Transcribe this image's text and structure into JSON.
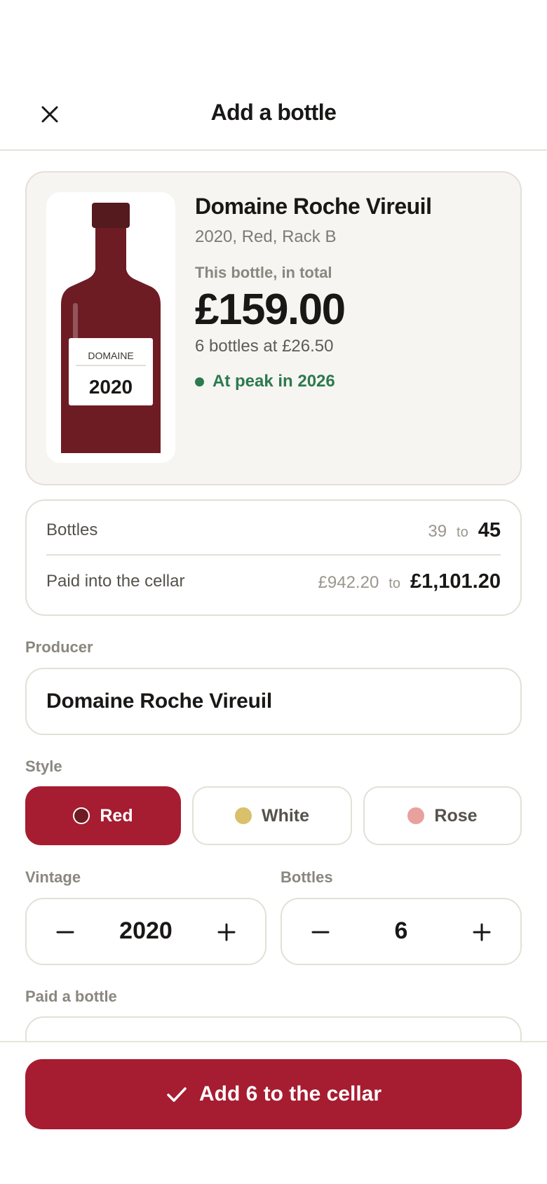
{
  "header": {
    "title": "Add a bottle",
    "close_icon": "close-icon"
  },
  "summary": {
    "name": "Domaine Roche Vireuil",
    "meta": "2020, Red, Rack B",
    "total_label": "This bottle, in total",
    "total_value": "£159.00",
    "per_bottle": "6 bottles at £26.50",
    "peak": "At peak in 2026",
    "label_producer": "DOMAINE",
    "label_year": "2020",
    "colors": {
      "bottle": "#6e1c24",
      "cap": "#541a1e",
      "peak": "#2c7a4e"
    }
  },
  "stats": {
    "bottles": {
      "label": "Bottles",
      "from": "39",
      "to_word": "to",
      "to": "45"
    },
    "paid": {
      "label": "Paid into the cellar",
      "from": "£942.20",
      "to_word": "to",
      "to": "£1,101.20"
    }
  },
  "form": {
    "producer_label": "Producer",
    "producer_value": "Domaine Roche Vireuil",
    "style_label": "Style",
    "styles": [
      {
        "label": "Red",
        "selected": true,
        "color": "#6e1c24"
      },
      {
        "label": "White",
        "selected": false,
        "color": "#d9c06a"
      },
      {
        "label": "Rose",
        "selected": false,
        "color": "#e8a19d"
      }
    ],
    "vintage_label": "Vintage",
    "vintage_value": "2020",
    "bottles_label": "Bottles",
    "bottles_value": "6",
    "paid_label": "Paid a bottle"
  },
  "footer": {
    "primary_label": "Add 6 to the cellar",
    "accent": "#a61c30"
  }
}
